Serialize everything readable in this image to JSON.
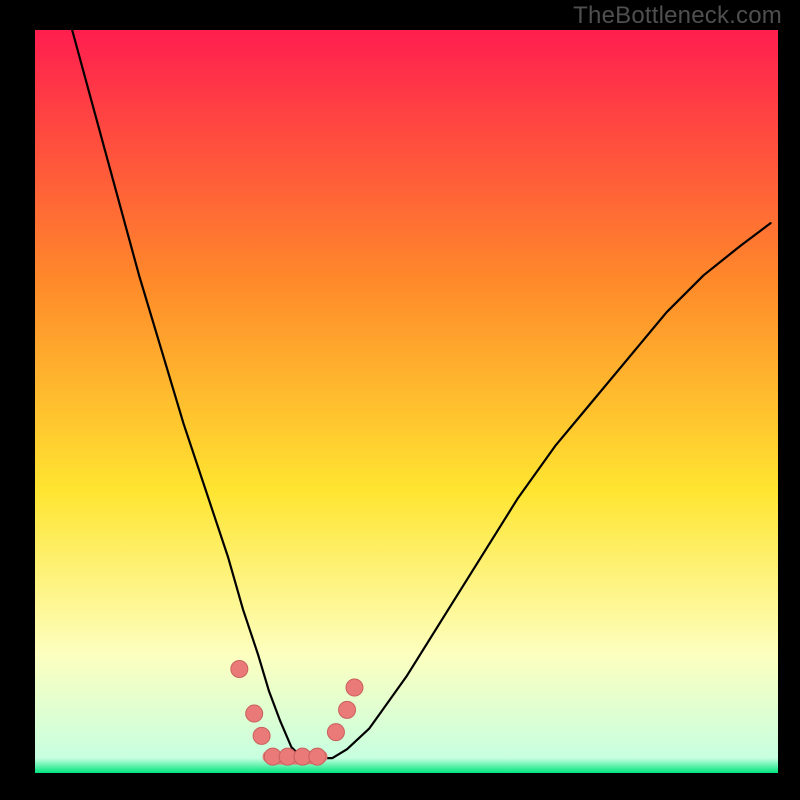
{
  "watermark": "TheBottleneck.com",
  "colors": {
    "bg": "#000000",
    "gradient_top": "#ff1e4f",
    "gradient_mid_upper": "#ff8a2a",
    "gradient_mid": "#ffe531",
    "gradient_lower": "#fdffbf",
    "gradient_bottom": "#00e57d",
    "curve": "#000000",
    "marker_fill": "#e97a78",
    "marker_stroke": "#c9605e",
    "watermark_text": "#4f4f4f"
  },
  "chart_data": {
    "type": "line",
    "title": "",
    "xlabel": "",
    "ylabel": "",
    "xlim": [
      0,
      100
    ],
    "ylim": [
      0,
      100
    ],
    "axes_visible": false,
    "grid": false,
    "series": [
      {
        "name": "bottleneck-curve",
        "x": [
          5,
          8,
          11,
          14,
          17,
          20,
          23,
          26,
          28,
          30,
          31.5,
          33,
          34.5,
          36,
          38,
          40,
          42,
          45,
          50,
          55,
          60,
          65,
          70,
          75,
          80,
          85,
          90,
          95,
          99
        ],
        "y": [
          100,
          89,
          78,
          67,
          57,
          47,
          38,
          29,
          22,
          16,
          11,
          7,
          3.5,
          2,
          2,
          2,
          3.2,
          6,
          13,
          21,
          29,
          37,
          44,
          50,
          56,
          62,
          67,
          71,
          74
        ]
      }
    ],
    "markers": [
      {
        "x": 27.5,
        "y": 14
      },
      {
        "x": 29.5,
        "y": 8
      },
      {
        "x": 30.5,
        "y": 5
      },
      {
        "x": 32.0,
        "y": 2.2
      },
      {
        "x": 34.0,
        "y": 2.2
      },
      {
        "x": 36.0,
        "y": 2.2
      },
      {
        "x": 38.0,
        "y": 2.2
      },
      {
        "x": 40.5,
        "y": 5.5
      },
      {
        "x": 42.0,
        "y": 8.5
      },
      {
        "x": 43.0,
        "y": 11.5
      }
    ],
    "segment_overlay": {
      "x": [
        31.5,
        33,
        34.5,
        36.5,
        38.5
      ],
      "y": [
        2.2,
        2.0,
        2.0,
        2.0,
        2.2
      ]
    }
  }
}
